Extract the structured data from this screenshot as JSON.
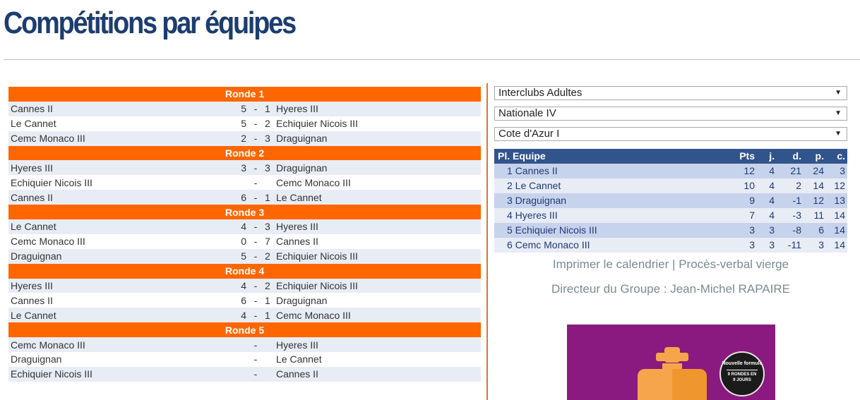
{
  "page": {
    "title": "Compétitions par équipes"
  },
  "rounds": [
    {
      "label": "Ronde 1",
      "matches": [
        {
          "home": "Cannes II",
          "score_home": "5",
          "score_away": "1",
          "away": "Hyeres III"
        },
        {
          "home": "Le Cannet",
          "score_home": "5",
          "score_away": "2",
          "away": "Echiquier Nicois III"
        },
        {
          "home": "Cemc Monaco III",
          "score_home": "2",
          "score_away": "3",
          "away": "Draguignan"
        }
      ]
    },
    {
      "label": "Ronde 2",
      "matches": [
        {
          "home": "Hyeres III",
          "score_home": "3",
          "score_away": "3",
          "away": "Draguignan"
        },
        {
          "home": "Echiquier Nicois III",
          "score_home": "",
          "score_away": "",
          "away": "Cemc Monaco III"
        },
        {
          "home": "Cannes II",
          "score_home": "6",
          "score_away": "1",
          "away": "Le Cannet"
        }
      ]
    },
    {
      "label": "Ronde 3",
      "matches": [
        {
          "home": "Le Cannet",
          "score_home": "4",
          "score_away": "3",
          "away": "Hyeres III"
        },
        {
          "home": "Cemc Monaco III",
          "score_home": "0",
          "score_away": "7",
          "away": "Cannes II"
        },
        {
          "home": "Draguignan",
          "score_home": "5",
          "score_away": "2",
          "away": "Echiquier Nicois III"
        }
      ]
    },
    {
      "label": "Ronde 4",
      "matches": [
        {
          "home": "Hyeres III",
          "score_home": "4",
          "score_away": "2",
          "away": "Echiquier Nicois III"
        },
        {
          "home": "Cannes II",
          "score_home": "6",
          "score_away": "1",
          "away": "Draguignan"
        },
        {
          "home": "Le Cannet",
          "score_home": "4",
          "score_away": "1",
          "away": "Cemc Monaco III"
        }
      ]
    },
    {
      "label": "Ronde 5",
      "matches": [
        {
          "home": "Cemc Monaco III",
          "score_home": "",
          "score_away": "",
          "away": "Hyeres III"
        },
        {
          "home": "Draguignan",
          "score_home": "",
          "score_away": "",
          "away": "Le Cannet"
        },
        {
          "home": "Echiquier Nicois III",
          "score_home": "",
          "score_away": "",
          "away": "Cannes II"
        }
      ]
    }
  ],
  "score_separator": "-",
  "selects": {
    "competition": "Interclubs Adultes",
    "division": "Nationale IV",
    "group": "Cote d'Azur I",
    "arrow": "▼"
  },
  "standings": {
    "headers": {
      "team": "Pl. Equipe",
      "pts": "Pts",
      "j": "j.",
      "d": "d.",
      "p": "p.",
      "c": "c."
    },
    "rows": [
      {
        "team": "1 Cannes II",
        "pts": "12",
        "j": "4",
        "d": "21",
        "p": "24",
        "c": "3"
      },
      {
        "team": "2 Le Cannet",
        "pts": "10",
        "j": "4",
        "d": "2",
        "p": "14",
        "c": "12"
      },
      {
        "team": "3 Draguignan",
        "pts": "9",
        "j": "4",
        "d": "-1",
        "p": "12",
        "c": "13"
      },
      {
        "team": "4 Hyeres III",
        "pts": "7",
        "j": "4",
        "d": "-3",
        "p": "11",
        "c": "14"
      },
      {
        "team": "5 Echiquier Nicois III",
        "pts": "3",
        "j": "3",
        "d": "-8",
        "p": "6",
        "c": "14"
      },
      {
        "team": "6 Cemc Monaco III",
        "pts": "3",
        "j": "3",
        "d": "-11",
        "p": "3",
        "c": "14"
      }
    ]
  },
  "links": {
    "print_calendar": "Imprimer le calendrier",
    "separator": "|",
    "blank_report": "Procès-verbal vierge"
  },
  "director": {
    "text": "Directeur du Groupe : Jean-Michel RAPAIRE"
  },
  "promo": {
    "badge_line1": "Nouvelle formule",
    "badge_line2": "9 RONDES EN 9 JOURS",
    "icon": "chess-king-icon"
  },
  "colors": {
    "title": "#1d3d6f",
    "round_header": "#ff6600",
    "standings_header": "#32548c",
    "row_alt": "#e8ecf5",
    "promo_bg": "#8a1a80",
    "piece": "#f7a54b"
  }
}
